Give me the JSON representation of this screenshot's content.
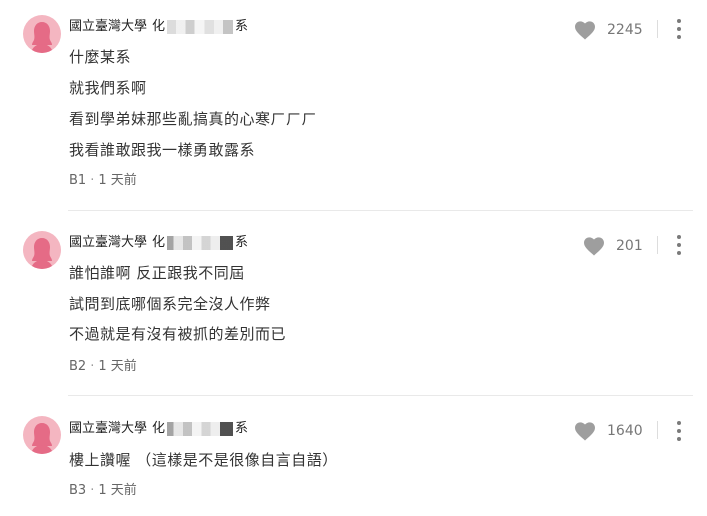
{
  "comments": [
    {
      "author_school": "國立臺灣大學",
      "author_dept_prefix": "化",
      "author_dept_suffix": "系",
      "lines": [
        "什麼某系",
        "就我們系啊",
        "看到學弟妹那些亂搞真的心寒ㄏㄏㄏ",
        "我看誰敢跟我一樣勇敢露系"
      ],
      "floor": "B1",
      "time": "1 天前",
      "likes": "2245",
      "avatar_icon": "female-avatar-icon",
      "avatar_color": "#f4b6c1"
    },
    {
      "author_school": "國立臺灣大學",
      "author_dept_prefix": "化",
      "author_dept_suffix": "系",
      "lines": [
        "誰怕誰啊 反正跟我不同屆",
        "試問到底哪個系完全沒人作弊",
        "不過就是有沒有被抓的差別而已"
      ],
      "floor": "B2",
      "time": "1 天前",
      "likes": "201",
      "avatar_icon": "female-avatar-icon",
      "avatar_color": "#f4b6c1"
    },
    {
      "author_school": "國立臺灣大學",
      "author_dept_prefix": "化",
      "author_dept_suffix": "系",
      "lines": [
        "樓上讚喔 （這樣是不是很像自言自語）"
      ],
      "floor": "B3",
      "time": "1 天前",
      "likes": "1640",
      "avatar_icon": "female-avatar-icon",
      "avatar_color": "#f4b6c1"
    }
  ],
  "meta_separator": "·",
  "icons": {
    "like": "heart-icon",
    "more": "more-vertical-icon"
  },
  "colors": {
    "text": "#333333",
    "meta": "#666666",
    "heart": "#9e9e9e",
    "divider": "#e9e9e9"
  }
}
